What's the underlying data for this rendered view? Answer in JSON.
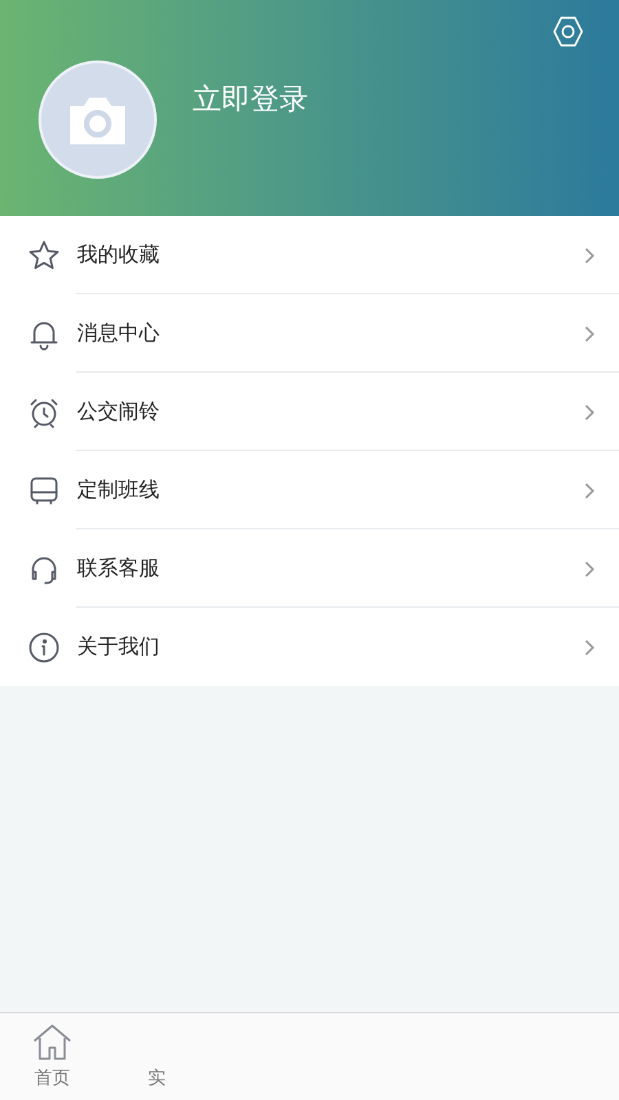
{
  "header": {
    "login_label": "立即登录"
  },
  "menu": [
    {
      "kind": "star",
      "label": "我的收藏"
    },
    {
      "kind": "bell",
      "label": "消息中心"
    },
    {
      "kind": "alarm",
      "label": "公交闹铃"
    },
    {
      "kind": "bus",
      "label": "定制班线"
    },
    {
      "kind": "headset",
      "label": "联系客服"
    },
    {
      "kind": "info",
      "label": "关于我们"
    }
  ],
  "tab_bar": [
    {
      "kind": "home",
      "label": "首页",
      "selected": false
    },
    {
      "kind": "none",
      "label": "实",
      "selected": false
    }
  ]
}
